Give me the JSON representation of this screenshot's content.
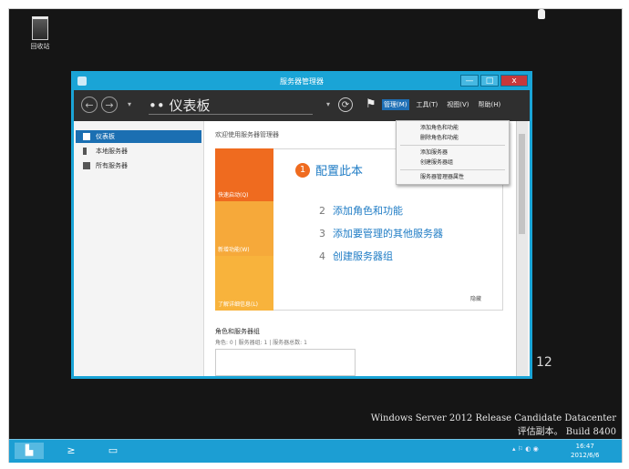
{
  "desktop": {
    "recycle_bin_label": "回收站",
    "build_number_fragment": "12",
    "watermark_line1": "Windows Server 2012 Release Candidate Datacenter",
    "watermark_line2": "评估副本。 Build 8400"
  },
  "window": {
    "title": "服务器管理器",
    "minimize": "—",
    "maximize": "□",
    "close": "x"
  },
  "navbar": {
    "breadcrumb": "•• 仪表板",
    "menus": [
      "管理(M)",
      "工具(T)",
      "视图(V)",
      "帮助(H)"
    ]
  },
  "sidebar": {
    "items": [
      {
        "label": "仪表板"
      },
      {
        "label": "本地服务器"
      },
      {
        "label": "所有服务器"
      }
    ]
  },
  "main": {
    "welcome": "欢迎使用服务器管理器",
    "tiles": [
      "快速启动(Q)",
      "新增功能(W)",
      "了解详细信息(L)"
    ],
    "step1_num": "1",
    "step1_text": "配置此本",
    "steps": [
      {
        "num": "2",
        "text": "添加角色和功能"
      },
      {
        "num": "3",
        "text": "添加要管理的其他服务器"
      },
      {
        "num": "4",
        "text": "创建服务器组"
      }
    ],
    "hide": "隐藏",
    "group_title": "角色和服务器组",
    "group_sub": "角色: 0 | 服务器组: 1 | 服务器总数: 1"
  },
  "dropdown": {
    "group1": [
      "添加角色和功能",
      "删除角色和功能"
    ],
    "group2": [
      "添加服务器",
      "创建服务器组"
    ],
    "group3": [
      "服务器管理器属性"
    ]
  },
  "taskbar": {
    "clock_time": "16:47",
    "clock_date": "2012/6/6"
  },
  "colors": {
    "accent": "#1aa4d6",
    "orange": "#ef6b1f",
    "link": "#1f7cc5"
  }
}
